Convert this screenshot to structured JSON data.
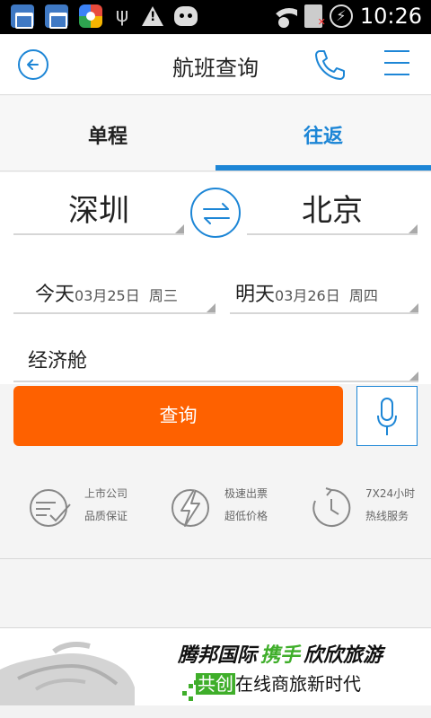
{
  "status_bar": {
    "time": "10:26",
    "battery_glyph": "⚡"
  },
  "header": {
    "title": "航班查询"
  },
  "tabs": {
    "one_way": "单程",
    "round_trip": "往返",
    "active": "round_trip"
  },
  "form": {
    "from_city": "深圳",
    "to_city": "北京",
    "departure": {
      "day": "今天",
      "date": "03月25日",
      "weekday": "周三"
    },
    "return": {
      "day": "明天",
      "date": "03月26日",
      "weekday": "周四"
    },
    "cabin": "经济舱"
  },
  "search_label": "查询",
  "features": [
    {
      "icon": "check-document-icon",
      "line1": "上市公司",
      "line2": "品质保证"
    },
    {
      "icon": "lightning-icon",
      "line1": "极速出票",
      "line2": "超低价格"
    },
    {
      "icon": "clock-icon",
      "line1": "7X24小时",
      "line2": "热线服务"
    }
  ],
  "banner": {
    "line1_a": "腾邦国际",
    "line1_b": "携手",
    "line1_c": "欣欣旅游",
    "line2_a": "共创",
    "line2_b": "在线商旅新时代"
  },
  "colors": {
    "accent": "#1d86d6",
    "search_button": "#fe6100",
    "banner_green": "#3fae2a"
  }
}
